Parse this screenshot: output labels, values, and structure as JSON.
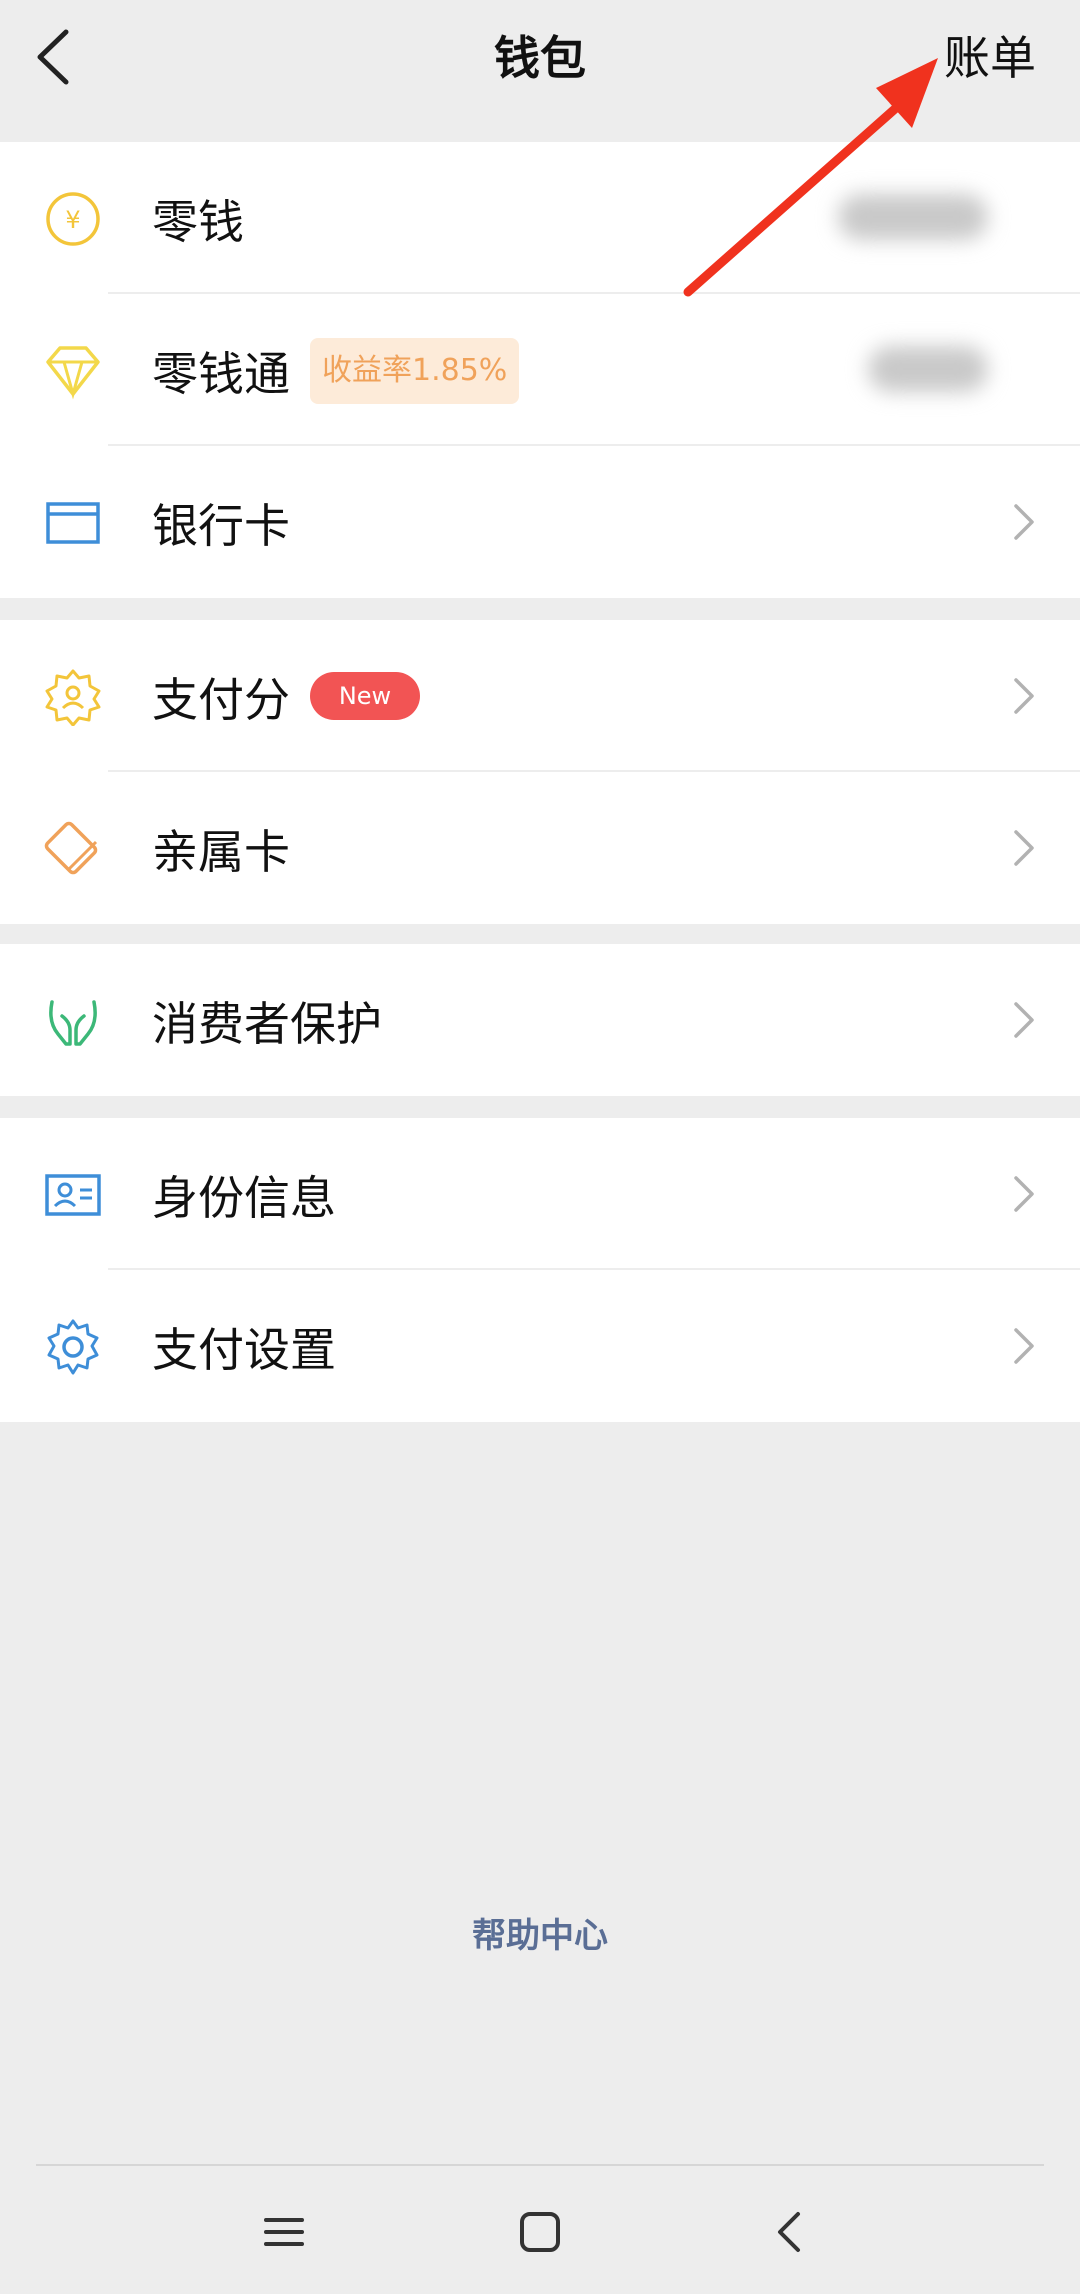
{
  "header": {
    "title": "钱包",
    "bill_label": "账单"
  },
  "groups": [
    {
      "items": [
        {
          "label": "零钱",
          "icon": "yuan-coin-icon"
        },
        {
          "label": "零钱通",
          "icon": "diamond-icon",
          "badge": "收益率1.85%"
        },
        {
          "label": "银行卡",
          "icon": "bank-card-icon"
        }
      ]
    },
    {
      "items": [
        {
          "label": "支付分",
          "icon": "pay-score-icon",
          "badge": "New"
        },
        {
          "label": "亲属卡",
          "icon": "family-card-icon"
        }
      ]
    },
    {
      "items": [
        {
          "label": "消费者保护",
          "icon": "hands-protect-icon"
        }
      ]
    },
    {
      "items": [
        {
          "label": "身份信息",
          "icon": "id-card-icon"
        },
        {
          "label": "支付设置",
          "icon": "gear-icon"
        }
      ]
    }
  ],
  "footer": {
    "help_center": "帮助中心"
  },
  "colors": {
    "background": "#ededed",
    "yellow_icon": "#f3c53a",
    "blue_icon": "#3e8ed8",
    "orange_icon": "#f0a25a",
    "green_icon": "#3cb878",
    "new_badge": "#f25454",
    "help_link": "#5a6e95",
    "annotation_arrow": "#f0321e"
  }
}
